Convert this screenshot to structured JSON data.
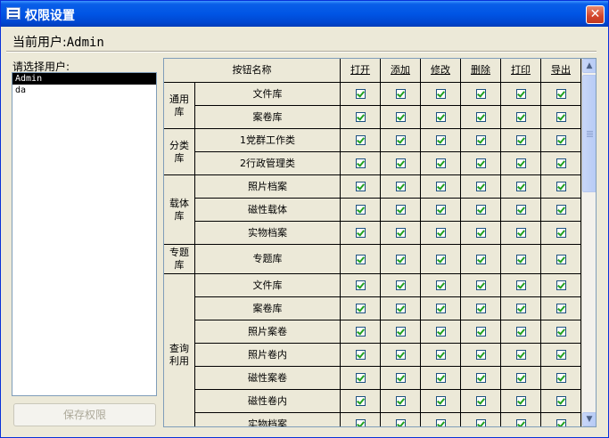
{
  "window": {
    "title": "权限设置",
    "close_glyph": "✕"
  },
  "current_user": {
    "label": "当前用户:",
    "value": "Admin"
  },
  "user_select": {
    "label": "请选择用户:",
    "users": [
      "Admin",
      "da"
    ],
    "selected": "Admin"
  },
  "save_button": {
    "label": "保存权限",
    "enabled": false
  },
  "grid": {
    "header": {
      "name_col": "按钮名称",
      "actions": [
        "打开",
        "添加",
        "修改",
        "删除",
        "打印",
        "导出"
      ]
    },
    "groups": [
      {
        "name": "通用库",
        "items": [
          "文件库",
          "案卷库"
        ]
      },
      {
        "name": "分类库",
        "items": [
          "1党群工作类",
          "2行政管理类"
        ]
      },
      {
        "name": "载体库",
        "items": [
          "照片档案",
          "磁性载体",
          "实物档案"
        ]
      },
      {
        "name": "专题库",
        "items": [
          "专题库"
        ]
      },
      {
        "name": "查询利用",
        "items": [
          "文件库",
          "案卷库",
          "照片案卷",
          "照片卷内",
          "磁性案卷",
          "磁性卷内",
          "实物档案"
        ]
      }
    ],
    "all_checked": true
  },
  "icons": [
    "window-icon",
    "close-icon",
    "checkbox-checked-icon",
    "scroll-up-icon",
    "scroll-down-icon"
  ]
}
